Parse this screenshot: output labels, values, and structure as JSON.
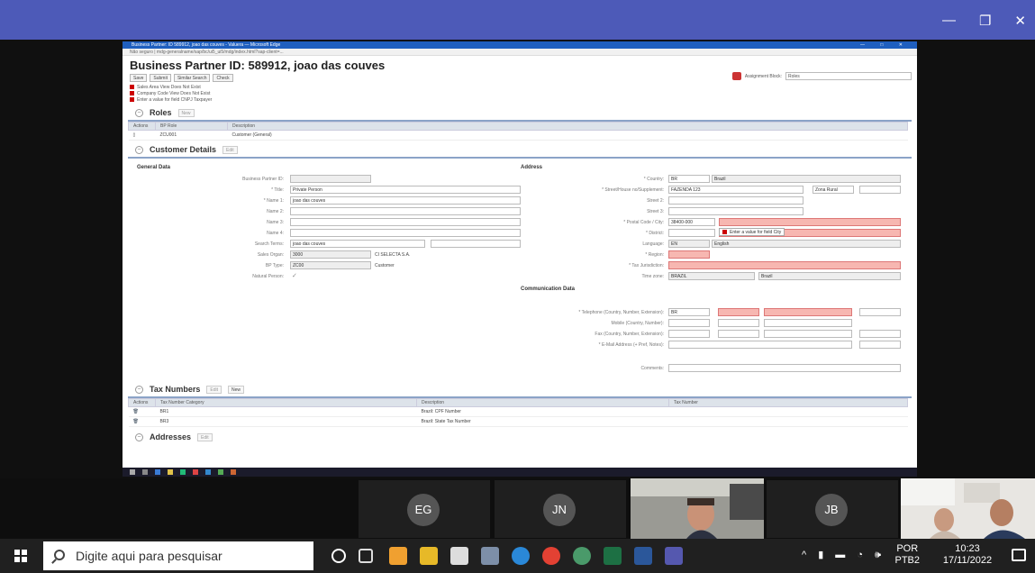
{
  "meeting": {
    "minimize": "—",
    "maximize": "❐",
    "close": "✕"
  },
  "browser": {
    "title": "Business Partner: ID 589912, joao das couves - Valuera — Microsoft Edge",
    "address": "Não seguro | mdg-generalname/sap/bc/ui5_ui5/mdg/index.html?sap-client=...",
    "controls": "— □ ✕"
  },
  "sap": {
    "title": "Business Partner ID: 589912, joao das couves",
    "toolbar": [
      "Save",
      "Submit",
      "Similar Search",
      "Check"
    ],
    "assignment_label": "Assignment Block:",
    "assignment_value": "Roles",
    "messages": [
      "Sales Area View Does Not Exist",
      "Company Code View Does Not Exist",
      "Enter a value for field CNPJ Taxpayer"
    ],
    "roles": {
      "title": "Roles",
      "new_btn": "New",
      "headers": [
        "Actions",
        "BP Role",
        "Description"
      ],
      "rows": [
        {
          "role": "ZCU001",
          "desc": "Customer (General)"
        }
      ]
    },
    "customer": {
      "title": "Customer Details",
      "edit_btn": "Edit",
      "general_title": "General Data",
      "address_title": "Address",
      "comm_title": "Communication Data",
      "general": {
        "bp_id_label": "Business Partner ID:",
        "title_label": "* Title:",
        "title_value": "Private Person",
        "name1_label": "* Name 1:",
        "name1_value": "joao das couves",
        "name2_label": "Name 2:",
        "name3_label": "Name 3:",
        "name4_label": "Name 4:",
        "search_label": "Search Terms:",
        "search_value": "joao das couves",
        "sales_org_label": "Sales Organ:",
        "sales_org_value": "3000",
        "sales_org_desc": "CI SELECTA S.A.",
        "bp_type_label": "BP Type:",
        "bp_type_value": "ZC00",
        "bp_type_desc": "Customer",
        "natural_label": "Natural Person:",
        "natural_value": "✓"
      },
      "address": {
        "country_label": "* Country:",
        "country_code": "BR",
        "country_name": "Brazil",
        "street_label": "* Street/House no/Supplement:",
        "street_value": "FAZENDA 123",
        "zona_value": "Zona Rural",
        "street2_label": "Street 2:",
        "street3_label": "Street 3:",
        "postal_label": "* Postal Code / City:",
        "postal_value": "38400-000",
        "district_label": "* District:",
        "error_tip": "Enter a value for field City",
        "language_label": "Language:",
        "language_code": "EN",
        "language_name": "English",
        "region_label": "* Region:",
        "jurisdiction_label": "* Tax Jurisdiction:",
        "timezone_label": "Time zone:",
        "timezone_value": "BRAZIL",
        "timezone_name": "Brazil"
      },
      "comm": {
        "tel_label": "* Telephone (Country, Number, Extension):",
        "tel_country": "BR",
        "mobile_label": "Mobile (Country, Number):",
        "fax_label": "Fax (Country, Number, Extension):",
        "email_label": "* E-Mail Address (+ Pref, Notes):",
        "comments_label": "Comments:"
      }
    },
    "tax": {
      "title": "Tax Numbers",
      "edit_btn": "Edit",
      "new_btn": "New",
      "headers": [
        "Actions",
        "Tax Number Category",
        "Description",
        "Tax Number"
      ],
      "rows": [
        {
          "cat": "BR1",
          "desc": "Brazil: CPF Number"
        },
        {
          "cat": "BR3",
          "desc": "Brazil: State Tax Number"
        }
      ]
    },
    "addresses": {
      "title": "Addresses",
      "edit_btn": "Edit"
    }
  },
  "gallery": [
    {
      "initials": "EG",
      "color": "#555555"
    },
    {
      "initials": "JN",
      "color": "#555555"
    },
    {
      "initials": "JB",
      "color": "#555555"
    }
  ],
  "taskbar": {
    "search_placeholder": "Digite aqui para pesquisar",
    "lang_top": "POR",
    "lang_bottom": "PTB2",
    "time": "10:23",
    "date": "17/11/2022",
    "tray_icons": "^ ▮ ▬ ◔ 🕪"
  }
}
